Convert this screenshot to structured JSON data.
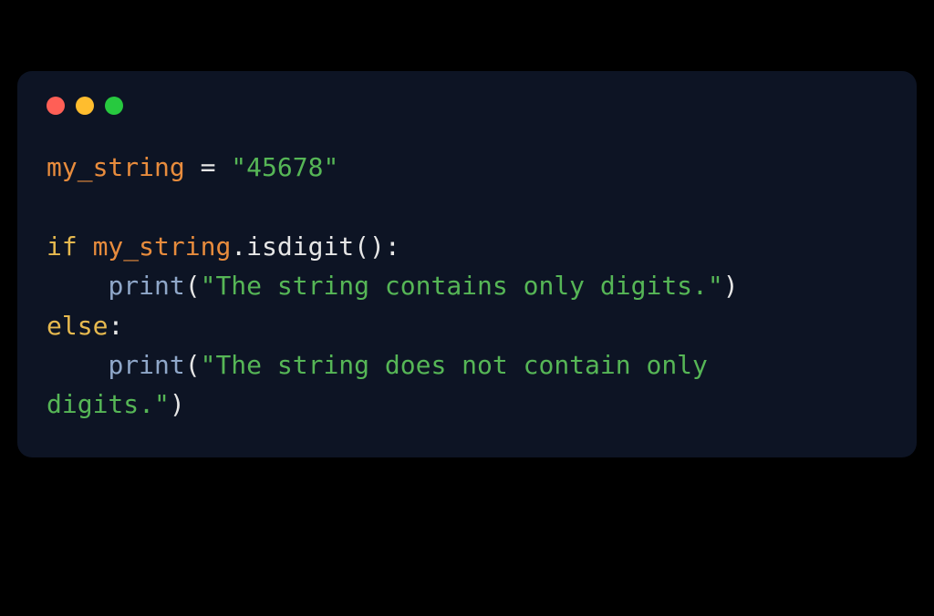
{
  "windowControls": {
    "red": "close",
    "yellow": "minimize",
    "green": "maximize"
  },
  "code": {
    "line1": {
      "var": "my_string",
      "op": " = ",
      "str": "\"45678\""
    },
    "line3": {
      "kw": "if",
      "space": " ",
      "var": "my_string",
      "dot": ".",
      "method": "isdigit",
      "parens": "()",
      "colon": ":"
    },
    "line4": {
      "indent": "    ",
      "fn": "print",
      "open": "(",
      "str": "\"The string contains only digits.\"",
      "close": ")"
    },
    "line5": {
      "kw": "else",
      "colon": ":"
    },
    "line6a": {
      "indent": "    ",
      "fn": "print",
      "open": "(",
      "str": "\"The string does not contain only "
    },
    "line6b": {
      "str": "digits.\"",
      "close": ")"
    }
  }
}
